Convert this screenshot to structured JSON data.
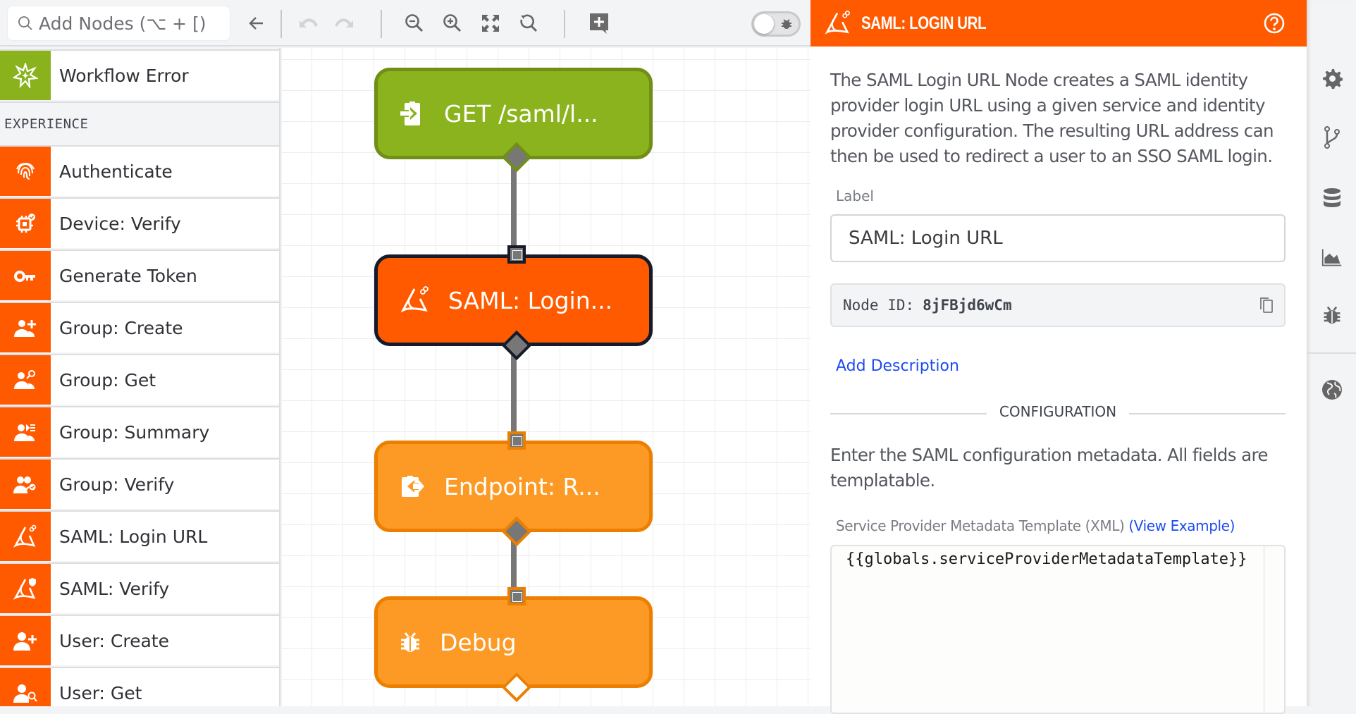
{
  "toolbar": {
    "search_placeholder": "Add Nodes (⌥ + [)",
    "buttons": [
      "back",
      "undo",
      "redo",
      "zoom-out",
      "zoom-in",
      "fit-to-screen",
      "reset-zoom",
      "add-note"
    ],
    "debug_toggle": {
      "on": false
    }
  },
  "palette": {
    "items_top": [
      {
        "label": "Workflow Error",
        "icon": "workflow-error-icon",
        "color": "#89b21d"
      }
    ],
    "section": "EXPERIENCE",
    "items": [
      {
        "label": "Authenticate",
        "icon": "fingerprint-icon"
      },
      {
        "label": "Device: Verify",
        "icon": "device-verify-icon"
      },
      {
        "label": "Generate Token",
        "icon": "key-icon"
      },
      {
        "label": "Group: Create",
        "icon": "group-add-icon"
      },
      {
        "label": "Group: Get",
        "icon": "group-search-icon"
      },
      {
        "label": "Group: Summary",
        "icon": "group-summary-icon"
      },
      {
        "label": "Group: Verify",
        "icon": "group-verify-icon"
      },
      {
        "label": "SAML: Login URL",
        "icon": "saml-link-icon"
      },
      {
        "label": "SAML: Verify",
        "icon": "saml-verify-icon"
      },
      {
        "label": "User: Create",
        "icon": "user-add-icon"
      },
      {
        "label": "User: Get",
        "icon": "user-search-icon"
      }
    ],
    "experience_color": "#ff5a00"
  },
  "canvas": {
    "nodes": [
      {
        "label": "GET /saml/l...",
        "type": "trigger",
        "fill": "#89b21d",
        "border": "#6f8e18",
        "selected": false
      },
      {
        "label": "SAML: Login...",
        "type": "experience",
        "fill": "#ff5a00",
        "border": "#161b2b",
        "selected": true
      },
      {
        "label": "Endpoint: R...",
        "type": "output",
        "fill": "#fd9a26",
        "border": "#ec7f00",
        "selected": false
      },
      {
        "label": "Debug",
        "type": "debug",
        "fill": "#fd9a26",
        "border": "#ec7f00",
        "selected": false
      }
    ]
  },
  "panel": {
    "title": "SAML: Login URL",
    "header_color": "#ff5a00",
    "description": "The SAML Login URL Node creates a SAML identity provider login URL using a given service and identity provider configuration. The resulting URL address can then be used to redirect a user to an SSO SAML login.",
    "label_field_label": "Label",
    "label_value": "SAML: Login URL",
    "node_id_label": "Node ID:",
    "node_id": "8jFBjd6wCm",
    "add_description": "Add Description",
    "section_title": "CONFIGURATION",
    "config_help": "Enter the SAML configuration metadata. All fields are templatable.",
    "sp_label": "Service Provider Metadata Template (XML)",
    "sp_example_link": "(View Example)",
    "sp_value": "{{globals.serviceProviderMetadataTemplate}}"
  },
  "sidebar_icons": [
    "gear-icon",
    "branch-icon",
    "database-icon",
    "chart-icon",
    "bug-icon",
    "globe-icon"
  ]
}
